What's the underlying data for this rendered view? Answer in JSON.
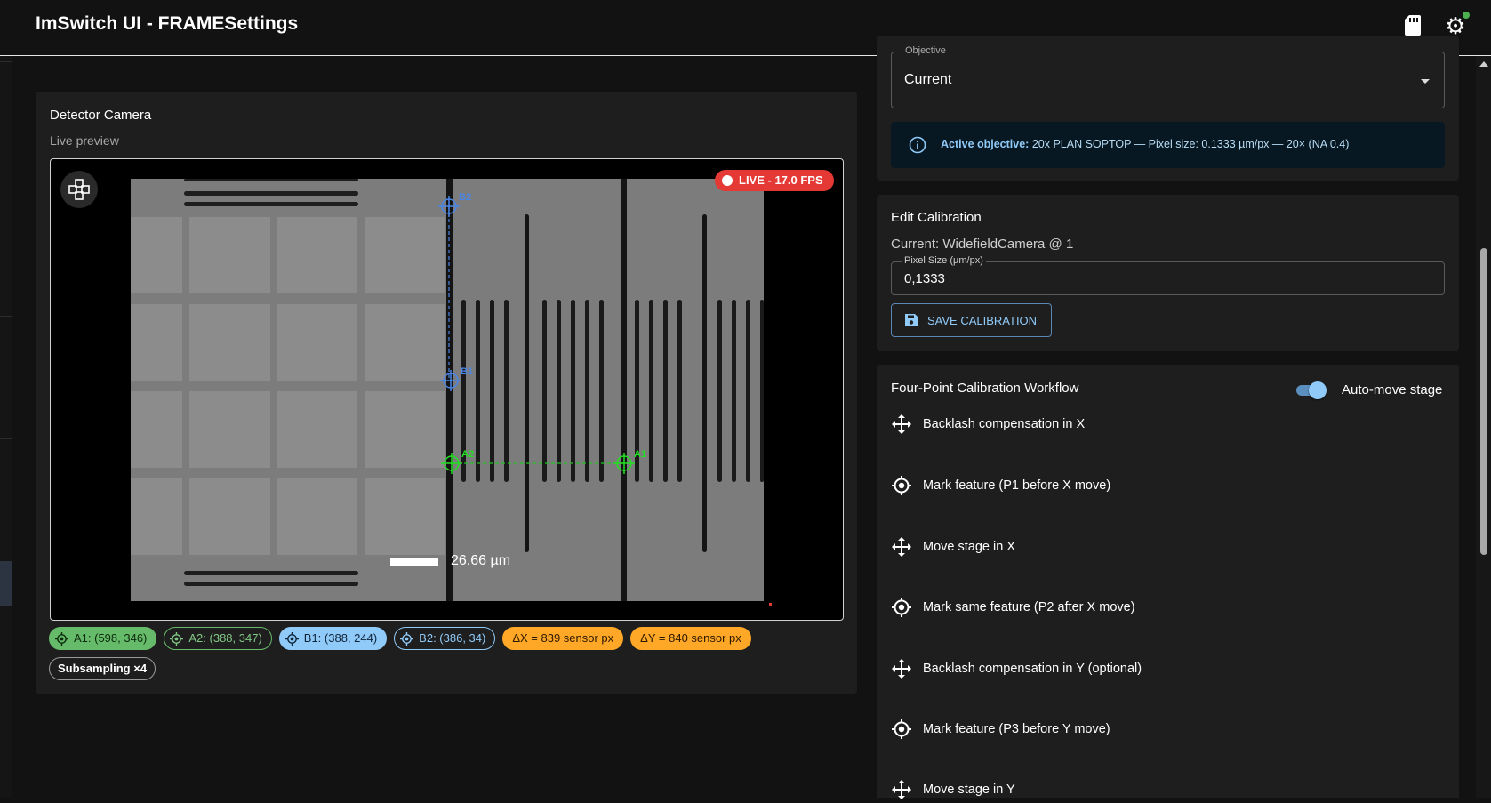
{
  "app": {
    "title": "ImSwitch UI - FRAMESettings",
    "sd_icon": "sd-card-icon",
    "gear_icon": "gear-icon"
  },
  "detector": {
    "title": "Detector Camera",
    "subtitle": "Live preview",
    "live_badge": "LIVE - 17.0 FPS",
    "scale_label": "26.66 µm",
    "points": {
      "a1": "A1",
      "a2": "A2",
      "b1": "B1",
      "b2": "B2"
    },
    "chips": {
      "a1": "A1: (598, 346)",
      "a2": "A2: (388, 347)",
      "b1": "B1: (388, 244)",
      "b2": "B2: (386, 34)",
      "dx": "ΔX = 839 sensor px",
      "dy": "ΔY = 840 sensor px",
      "subsampling": "Subsampling ×4"
    }
  },
  "objective": {
    "label": "Objective",
    "value": "Current",
    "info_label": "Active objective:",
    "info_text": "20x PLAN SOPTOP — Pixel size: 0.1333 µm/px — 20× (NA 0.4)"
  },
  "calibration": {
    "title": "Edit Calibration",
    "current": "Current: WidefieldCamera @ 1",
    "pixel_label": "Pixel Size (µm/px)",
    "pixel_value": "0,1333",
    "save_label": "SAVE CALIBRATION"
  },
  "workflow": {
    "title": "Four-Point Calibration Workflow",
    "auto_move_label": "Auto-move stage",
    "auto_move_on": true,
    "steps": [
      {
        "label": "Backlash compensation in X",
        "icon": "move-icon"
      },
      {
        "label": "Mark feature (P1 before X move)",
        "icon": "target-icon"
      },
      {
        "label": "Move stage in X",
        "icon": "move-icon"
      },
      {
        "label": "Mark same feature (P2 after X move)",
        "icon": "target-icon"
      },
      {
        "label": "Backlash compensation in Y (optional)",
        "icon": "move-icon"
      },
      {
        "label": "Mark feature (P3 before Y move)",
        "icon": "target-icon"
      },
      {
        "label": "Move stage in Y",
        "icon": "move-icon"
      }
    ]
  },
  "colors": {
    "green": "#66bb6a",
    "blue": "#90caf9",
    "orange": "#ffa726",
    "live_red": "#e53935"
  }
}
